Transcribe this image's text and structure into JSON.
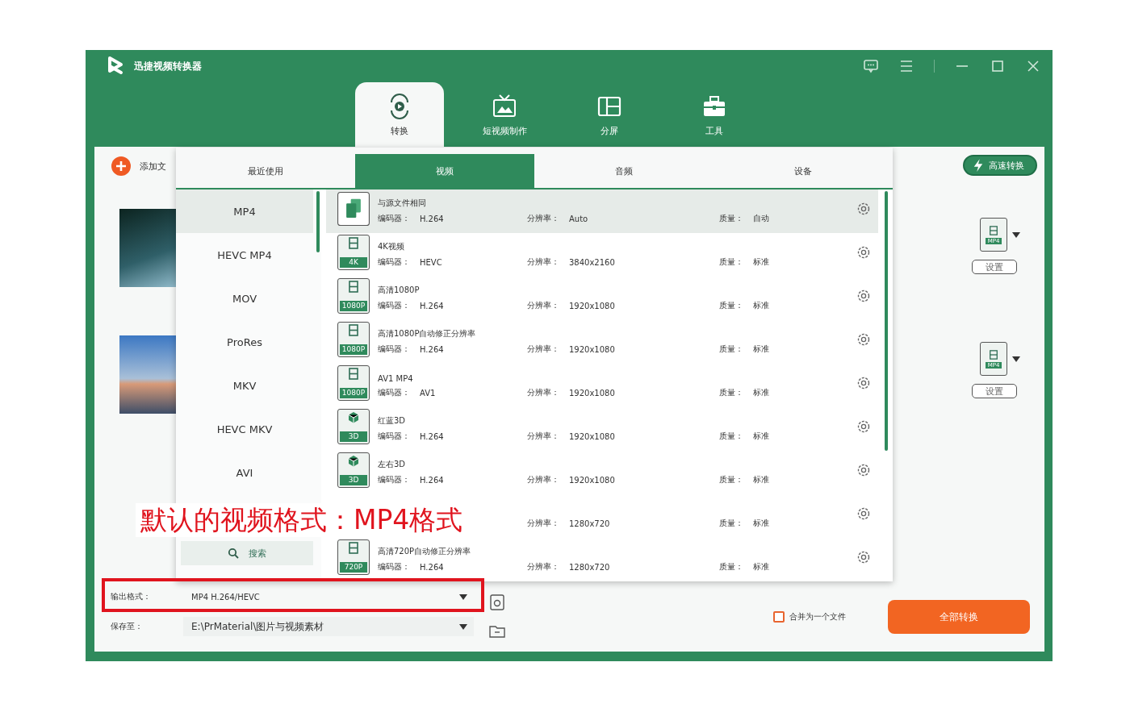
{
  "window": {
    "title": "迅捷视频转换器"
  },
  "main_tabs": [
    {
      "label": "转换",
      "selected": true
    },
    {
      "label": "短视频制作",
      "selected": false
    },
    {
      "label": "分屏",
      "selected": false
    },
    {
      "label": "工具",
      "selected": false
    }
  ],
  "add_file": {
    "label": "添加文"
  },
  "fast_convert": {
    "label": "高速转换"
  },
  "files": [
    {
      "format_badge": "MP4",
      "settings": "设置"
    },
    {
      "format_badge": "MP4",
      "settings": "设置"
    }
  ],
  "format_popup": {
    "tabs": [
      {
        "label": "最近使用",
        "selected": false
      },
      {
        "label": "视频",
        "selected": true
      },
      {
        "label": "音频",
        "selected": false
      },
      {
        "label": "设备",
        "selected": false
      }
    ],
    "formats": [
      {
        "label": "MP4",
        "selected": true
      },
      {
        "label": "HEVC MP4",
        "selected": false
      },
      {
        "label": "MOV",
        "selected": false
      },
      {
        "label": "ProRes",
        "selected": false
      },
      {
        "label": "MKV",
        "selected": false
      },
      {
        "label": "HEVC MKV",
        "selected": false
      },
      {
        "label": "AVI",
        "selected": false
      }
    ],
    "search": {
      "label": "搜索"
    },
    "presets": [
      {
        "kind": "copy",
        "title": "与源文件相同",
        "codec_label": "编码器：",
        "codec": "H.264",
        "res_label": "分辨率：",
        "res": "Auto",
        "quality_label": "质量：",
        "quality": "自动",
        "selected": true
      },
      {
        "kind": "film",
        "badge": "4K",
        "title": "4K视频",
        "codec_label": "编码器：",
        "codec": "HEVC",
        "res_label": "分辨率：",
        "res": "3840x2160",
        "quality_label": "质量：",
        "quality": "标准",
        "selected": false
      },
      {
        "kind": "film",
        "badge": "1080P",
        "title": "高清1080P",
        "codec_label": "编码器：",
        "codec": "H.264",
        "res_label": "分辨率：",
        "res": "1920x1080",
        "quality_label": "质量：",
        "quality": "标准",
        "selected": false
      },
      {
        "kind": "film",
        "badge": "1080P",
        "title": "高清1080P自动修正分辨率",
        "codec_label": "编码器：",
        "codec": "H.264",
        "res_label": "分辨率：",
        "res": "1920x1080",
        "quality_label": "质量：",
        "quality": "标准",
        "selected": false
      },
      {
        "kind": "film",
        "badge": "1080P",
        "title": "AV1 MP4",
        "codec_label": "编码器：",
        "codec": "AV1",
        "res_label": "分辨率：",
        "res": "1920x1080",
        "quality_label": "质量：",
        "quality": "标准",
        "selected": false
      },
      {
        "kind": "cube",
        "badge": "3D",
        "title": "红蓝3D",
        "codec_label": "编码器：",
        "codec": "H.264",
        "res_label": "分辨率：",
        "res": "1920x1080",
        "quality_label": "质量：",
        "quality": "标准",
        "selected": false
      },
      {
        "kind": "cube",
        "badge": "3D",
        "title": "左右3D",
        "codec_label": "编码器：",
        "codec": "H.264",
        "res_label": "分辨率：",
        "res": "1920x1080",
        "quality_label": "质量：",
        "quality": "标准",
        "selected": false
      },
      {
        "kind": "hidden",
        "res_label": "分辨率：",
        "res": "1280x720",
        "quality_label": "质量：",
        "quality": "标准",
        "selected": false
      },
      {
        "kind": "film",
        "badge": "720P",
        "title": "高清720P自动修正分辨率",
        "codec_label": "编码器：",
        "codec": "H.264",
        "res_label": "分辨率：",
        "res": "1280x720",
        "quality_label": "质量：",
        "quality": "标准",
        "selected": false
      }
    ]
  },
  "bottom": {
    "output_label": "输出格式：",
    "output_value": "MP4 H.264/HEVC",
    "save_label": "保存至：",
    "save_value": "E:\\PrMaterial\\图片与视频素材",
    "merge": {
      "label": "合并为一个文件",
      "checked": false
    },
    "convert_all": "全部转换"
  },
  "annotation": {
    "text": "默认的视频格式：MP4格式"
  }
}
